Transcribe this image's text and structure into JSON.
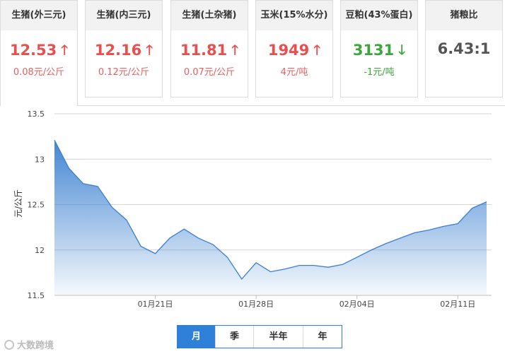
{
  "cards": [
    {
      "title": "生猪(外三元)",
      "price": "12.53",
      "arrow": "🡑",
      "direction": "up",
      "change": "0.08元/公斤"
    },
    {
      "title": "生猪(内三元)",
      "price": "12.16",
      "arrow": "🡑",
      "direction": "up",
      "change": "0.12元/公斤"
    },
    {
      "title": "生猪(土杂猪)",
      "price": "11.81",
      "arrow": "🡑",
      "direction": "up",
      "change": "0.07元/公斤"
    },
    {
      "title": "玉米(15%水分)",
      "price": "1949",
      "arrow": "🡑",
      "direction": "up",
      "change": "4元/吨"
    },
    {
      "title": "豆粕(43%蛋白)",
      "price": "3131",
      "arrow": "🡓",
      "direction": "down",
      "change": "-1元/吨"
    },
    {
      "title": "猪粮比",
      "price": "6.43:1",
      "arrow": "",
      "direction": "flat",
      "change": ""
    }
  ],
  "colors": {
    "up": "#e85050",
    "down": "#3ba63b",
    "accent": "#2f80d8",
    "series": "#3a7fd0"
  },
  "chart_data": {
    "type": "area",
    "ylabel": "元/公斤",
    "ylim": [
      11.5,
      13.5
    ],
    "yticks": [
      "11.5",
      "12",
      "12.5",
      "13",
      "13.5"
    ],
    "xticks": [
      {
        "index": 7,
        "label": "01月21日"
      },
      {
        "index": 14,
        "label": "01月28日"
      },
      {
        "index": 21,
        "label": "02月04日"
      },
      {
        "index": 28,
        "label": "02月11日"
      }
    ],
    "series": [
      {
        "values": [
          13.21,
          12.9,
          12.73,
          12.7,
          12.47,
          12.33,
          12.04,
          11.96,
          12.13,
          12.23,
          12.13,
          12.06,
          11.92,
          11.68,
          11.86,
          11.76,
          11.79,
          11.83,
          11.83,
          11.81,
          11.84,
          11.92,
          12.0,
          12.07,
          12.13,
          12.19,
          12.22,
          12.26,
          12.29,
          12.46,
          12.53
        ]
      }
    ]
  },
  "tabs": [
    {
      "label": "月",
      "active": true
    },
    {
      "label": "季",
      "active": false
    },
    {
      "label": "半年",
      "active": false
    },
    {
      "label": "年",
      "active": false
    }
  ],
  "watermark": "大数跨境"
}
